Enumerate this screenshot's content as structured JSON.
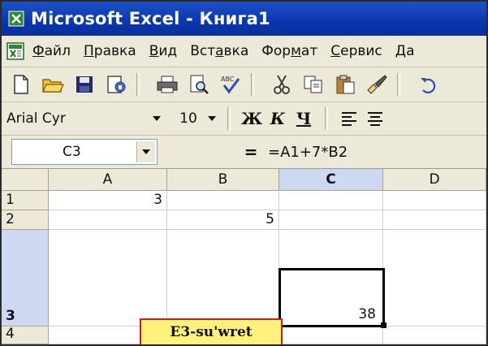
{
  "window": {
    "title": "Microsoft Excel - Книга1",
    "app_icon": "excel-icon"
  },
  "menu": {
    "doc_icon": "document-icon",
    "items": [
      {
        "label": "Файл",
        "accel": "Ф"
      },
      {
        "label": "Правка",
        "accel": "П"
      },
      {
        "label": "Вид",
        "accel": "В"
      },
      {
        "label": "Вставка",
        "accel": "а"
      },
      {
        "label": "Формат",
        "accel": "м"
      },
      {
        "label": "Сервис",
        "accel": "С"
      },
      {
        "label": "Да",
        "accel": "Д"
      }
    ]
  },
  "toolbar": {
    "buttons": [
      "new-icon",
      "open-icon",
      "save-icon",
      "permissions-icon",
      "print-icon",
      "print-preview-icon",
      "spelling-icon",
      "cut-icon",
      "copy-icon",
      "paste-icon",
      "format-painter-icon",
      "undo-icon"
    ]
  },
  "formatting": {
    "font_name": "Arial Cyr",
    "font_size": "10",
    "bold_label": "Ж",
    "italic_label": "К",
    "underline_label": "Ч",
    "align_buttons": [
      "align-left-icon",
      "align-center-icon"
    ]
  },
  "formula_bar": {
    "name_box": "C3",
    "equals_label": "=",
    "formula": "=A1+7*B2"
  },
  "grid": {
    "columns": [
      "A",
      "B",
      "C",
      "D"
    ],
    "rows": [
      "1",
      "2",
      "3",
      "4"
    ],
    "selected_column": "C",
    "selected_row": "3",
    "cells": {
      "A1": "3",
      "B2": "5",
      "C3": "38"
    }
  },
  "caption": {
    "text": "E3-su'wret"
  },
  "colors": {
    "title_bar": "#0a36b0",
    "caption_bg": "#fff27a",
    "caption_border": "#d21a1a",
    "selection": "#cdd9f3"
  }
}
